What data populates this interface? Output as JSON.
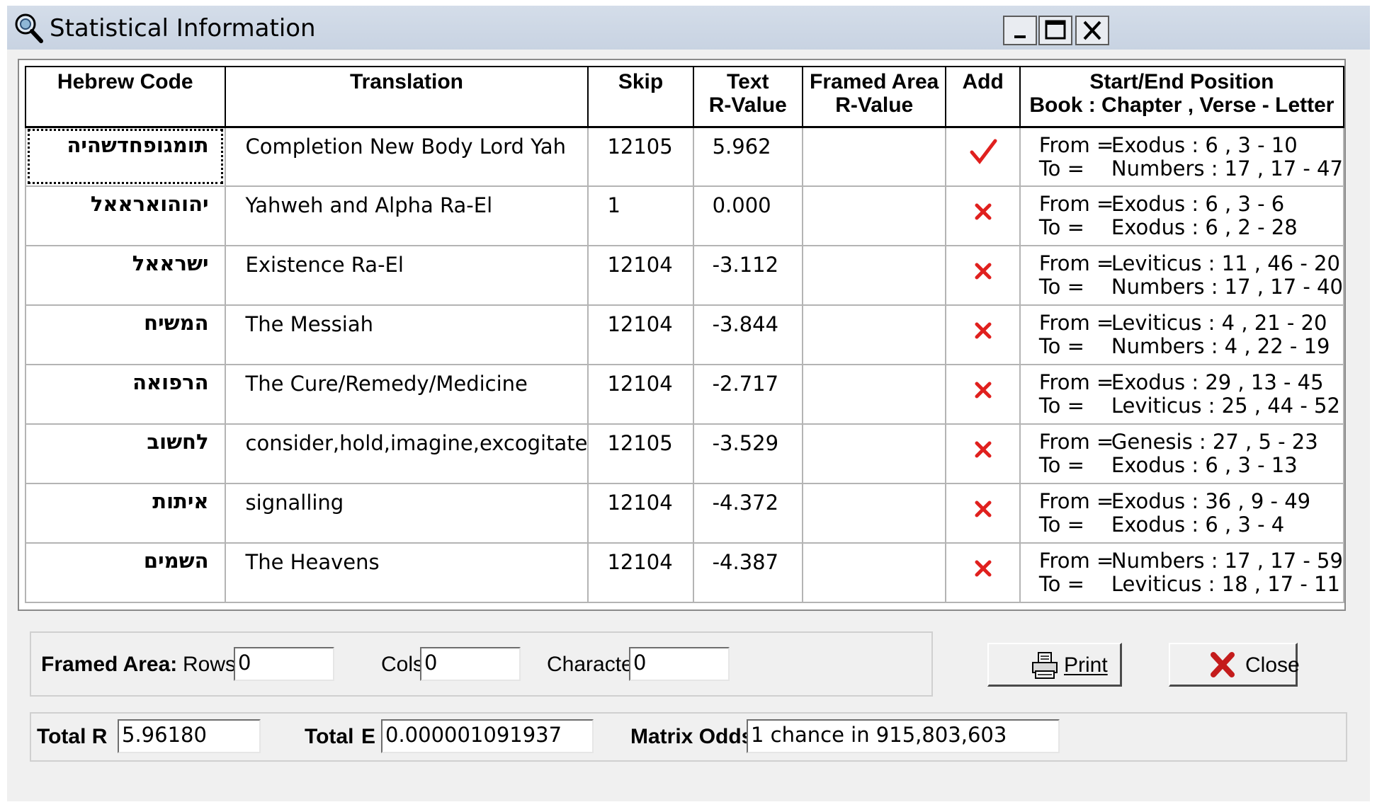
{
  "window": {
    "title": "Statistical Information",
    "icon": "magnifier-icon",
    "controls": [
      "minimize-icon",
      "maximize-icon",
      "close-icon"
    ]
  },
  "grid": {
    "headers": {
      "hebrew_code": "Hebrew Code",
      "translation": "Translation",
      "skip": "Skip",
      "text_r_1": "Text",
      "text_r_2": "R-Value",
      "framed_1": "Framed Area",
      "framed_2": "R-Value",
      "add": "Add",
      "pos_1": "Start/End Position",
      "pos_2": "Book : Chapter , Verse - Letter"
    },
    "from_label": "From =",
    "to_label": "To =",
    "rows": [
      {
        "hebrew": "תומגופחדשהיה",
        "translation": "Completion New Body Lord Yah",
        "skip": "12105",
        "text_r": "5.962",
        "framed_r": "",
        "add": true,
        "from": "Exodus : 6 , 3 - 10",
        "to": "Numbers : 17 , 17 - 47"
      },
      {
        "hebrew": "יהוהוארא‎אל",
        "translation": "Yahweh and Alpha Ra-El",
        "skip": "1",
        "text_r": "0.000",
        "framed_r": "",
        "add": false,
        "from": "Exodus : 6 , 3 - 6",
        "to": "Exodus : 6 , 2 - 28"
      },
      {
        "hebrew": "ישראאל",
        "translation": "Existence Ra-El",
        "skip": "12104",
        "text_r": "-3.112",
        "framed_r": "",
        "add": false,
        "from": "Leviticus : 11 , 46 - 20",
        "to": "Numbers : 17 , 17 - 40"
      },
      {
        "hebrew": "המשיח",
        "translation": "The Messiah",
        "skip": "12104",
        "text_r": "-3.844",
        "framed_r": "",
        "add": false,
        "from": "Leviticus : 4 , 21 - 20",
        "to": "Numbers : 4 , 22 - 19"
      },
      {
        "hebrew": "הרפואה",
        "translation": "The Cure/Remedy/Medicine",
        "skip": "12104",
        "text_r": "-2.717",
        "framed_r": "",
        "add": false,
        "from": "Exodus : 29 , 13 - 45",
        "to": "Leviticus : 25 , 44 - 52"
      },
      {
        "hebrew": "לחשוב",
        "translation": "consider,hold,imagine,excogitate",
        "skip": "12105",
        "text_r": "-3.529",
        "framed_r": "",
        "add": false,
        "from": "Genesis : 27 , 5 - 23",
        "to": "Exodus : 6 , 3 - 13"
      },
      {
        "hebrew": "איתות",
        "translation": "signalling",
        "skip": "12104",
        "text_r": "-4.372",
        "framed_r": "",
        "add": false,
        "from": "Exodus : 36 , 9 - 49",
        "to": "Exodus : 6 , 3 - 4"
      },
      {
        "hebrew": "השמים",
        "translation": "The Heavens",
        "skip": "12104",
        "text_r": "-4.387",
        "framed_r": "",
        "add": false,
        "from": "Numbers : 17 , 17 - 59",
        "to": "Leviticus : 18 , 17 - 11"
      }
    ]
  },
  "framed_area": {
    "label": "Framed Area:",
    "rows_label": "Rows",
    "rows_value": "0",
    "cols_label": "Cols",
    "cols_value": "0",
    "chars_label": "Characters",
    "chars_value": "0"
  },
  "buttons": {
    "print": "Print",
    "print_icon": "printer-icon",
    "close": "Close",
    "close_icon": "red-x-icon"
  },
  "totals": {
    "total_r_label": "Total R",
    "total_r_value": "5.96180",
    "total_e_label": "Total",
    "total_e_letter": "E",
    "total_e_value": "0.000001091937",
    "matrix_odds_label": "Matrix Odds",
    "matrix_odds_value": "1 chance in 915,803,603"
  },
  "colors": {
    "check": "#e0201e",
    "cross": "#e0201e"
  }
}
